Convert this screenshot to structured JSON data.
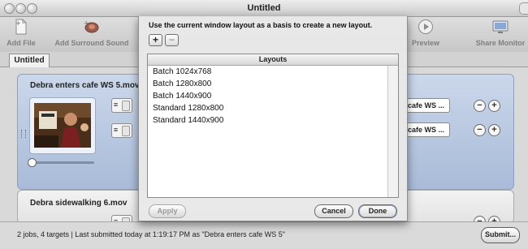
{
  "window": {
    "title": "Untitled"
  },
  "toolbar": {
    "add_file": "Add File",
    "add_surround_sound": "Add Surround Sound",
    "preview": "Preview",
    "share_monitor": "Share Monitor"
  },
  "tabs": [
    {
      "label": "Untitled"
    }
  ],
  "jobs": [
    {
      "title": "Debra enters cafe WS 5.mov",
      "targets": [
        {
          "destination": "cafe WS ..."
        },
        {
          "destination": "cafe WS ..."
        }
      ]
    },
    {
      "title": "Debra sidewalking 6.mov"
    }
  ],
  "sheet": {
    "message": "Use the current window layout as a basis to create a new layout.",
    "add_symbol": "+",
    "remove_symbol": "−",
    "list_header": "Layouts",
    "layouts": [
      "Batch 1024x768",
      "Batch 1280x800",
      "Batch 1440x900",
      "Standard 1280x800",
      "Standard 1440x900"
    ],
    "apply_label": "Apply",
    "cancel_label": "Cancel",
    "done_label": "Done"
  },
  "status": {
    "summary": "2 jobs, 4 targets   |   Last submitted today at 1:19:17 PM as \"Debra enters cafe WS 5\"",
    "submit_label": "Submit..."
  },
  "colors": {
    "job_selected": "#b7c7e2",
    "sheet_bg": "#e8e8e8"
  }
}
